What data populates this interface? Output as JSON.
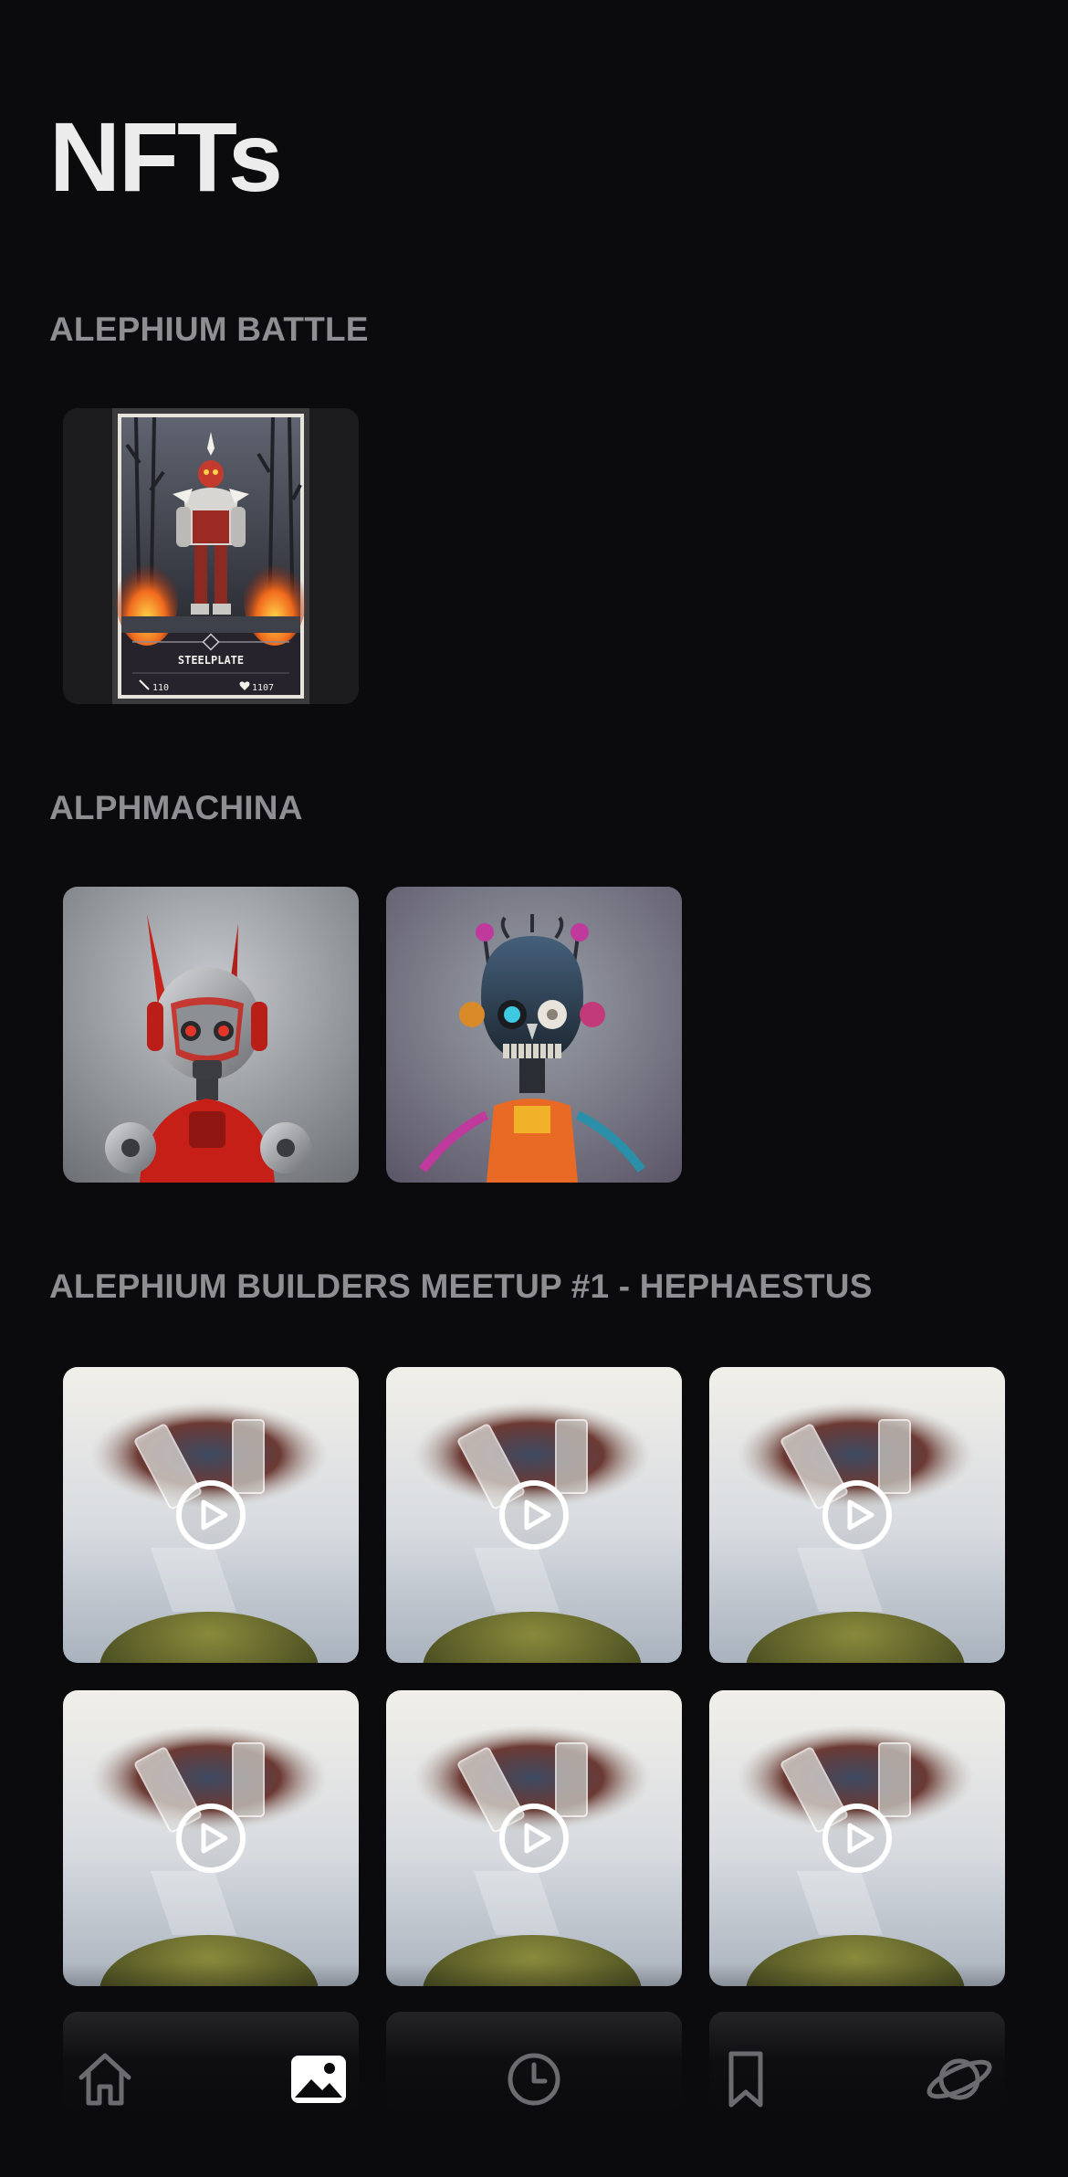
{
  "page": {
    "title": "NFTs"
  },
  "collections": [
    {
      "name": "ALEPHIUM BATTLE",
      "items": [
        {
          "kind": "card",
          "card_name": "STEELPLATE",
          "stat_left": "110",
          "stat_right": "1107"
        }
      ]
    },
    {
      "name": "ALPHMACHINA",
      "items": [
        {
          "kind": "image",
          "subject": "red-robot"
        },
        {
          "kind": "image",
          "subject": "skull-robot"
        }
      ]
    },
    {
      "name": "ALEPHIUM BUILDERS MEETUP #1 - HEPHAESTUS",
      "items": [
        {
          "kind": "video",
          "subject": "glass-trophy"
        },
        {
          "kind": "video",
          "subject": "glass-trophy"
        },
        {
          "kind": "video",
          "subject": "glass-trophy"
        },
        {
          "kind": "video",
          "subject": "glass-trophy"
        },
        {
          "kind": "video",
          "subject": "glass-trophy"
        },
        {
          "kind": "video",
          "subject": "glass-trophy"
        }
      ]
    }
  ],
  "tabbar": {
    "tabs": [
      {
        "icon": "home-icon",
        "active": false
      },
      {
        "icon": "gallery-icon",
        "active": true
      },
      {
        "icon": "clock-icon",
        "active": false
      },
      {
        "icon": "bookmark-icon",
        "active": false
      },
      {
        "icon": "planet-icon",
        "active": false
      }
    ]
  },
  "colors": {
    "background": "#0b0b0d",
    "title": "#ececec",
    "section_label": "#8e8e93",
    "icon_inactive": "#6b6b70",
    "icon_active": "#ffffff"
  }
}
